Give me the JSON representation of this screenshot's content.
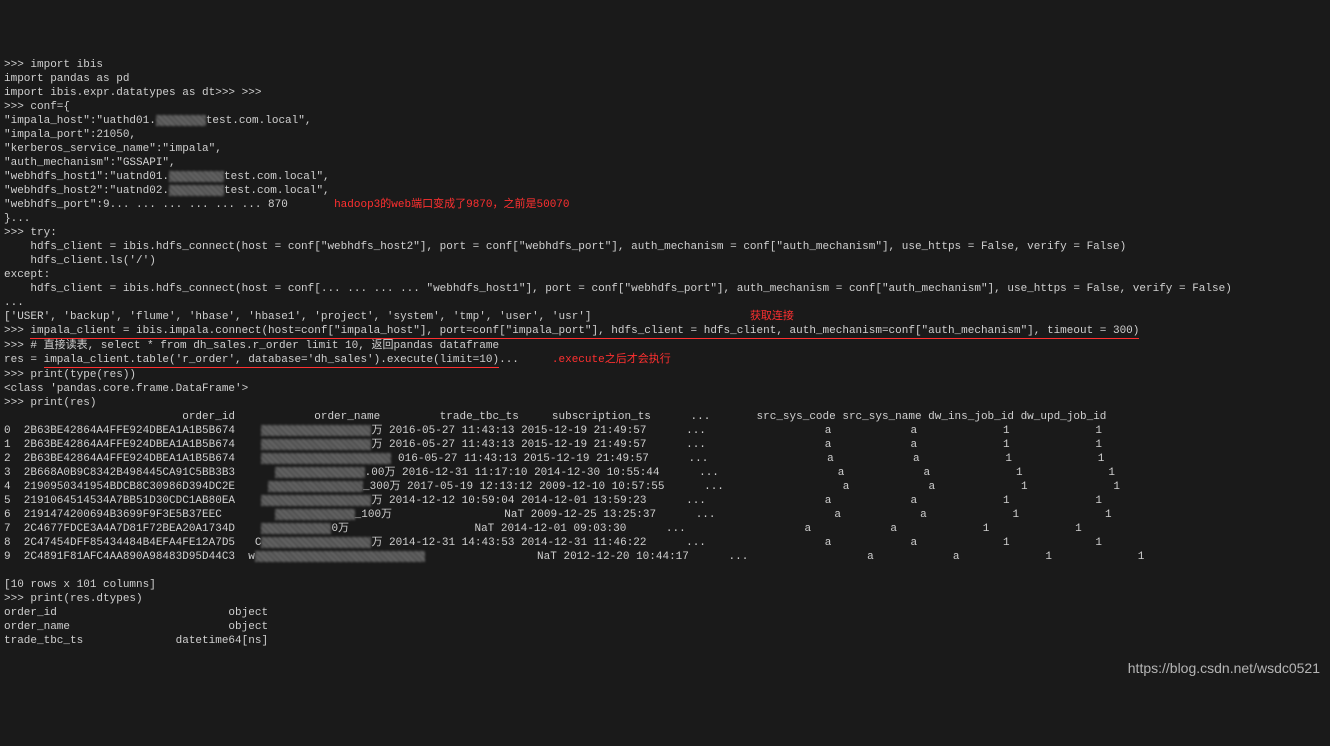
{
  "lines": {
    "l1": ">>> import ibis",
    "l2": "import pandas as pd",
    "l3": "import ibis.expr.datatypes as dt>>> >>>",
    "l4": ">>> conf={",
    "l5": "\"impala_host\":\"uathd01.        test.com.local\",",
    "l6": "\"impala_port\":21050,",
    "l7": "\"kerberos_service_name\":\"impala\",",
    "l8": "\"auth_mechanism\":\"GSSAPI\",",
    "l9": "\"webhdfs_host1\":\"uatnd01.          test.com.local\",",
    "l10": "\"webhdfs_host2\":\"uatnd02.          test.com.local\",",
    "l11": "\"webhdfs_port\":9... ... ... ... ... ... 870",
    "ann1": "hadoop3的web端口变成了9870，之前是50070",
    "l12": "}...",
    "l13": ">>> try:",
    "l14": "    hdfs_client = ibis.hdfs_connect(host = conf[\"webhdfs_host2\"], port = conf[\"webhdfs_port\"], auth_mechanism = conf[\"auth_mechanism\"], use_https = False, verify = False)",
    "l15": "    hdfs_client.ls('/')",
    "l16": "except:",
    "l17": "    hdfs_client = ibis.hdfs_connect(host = conf[... ... ... ... \"webhdfs_host1\"], port = conf[\"webhdfs_port\"], auth_mechanism = conf[\"auth_mechanism\"], use_https = False, verify = False)",
    "l18": "...",
    "l19": "['USER', 'backup', 'flume', 'hbase', 'hbase1', 'project', 'system', 'tmp', 'user', 'usr']",
    "ann2": "获取连接",
    "l20": ">>> impala_client = ibis.impala.connect(host=conf[\"impala_host\"], port=conf[\"impala_port\"], hdfs_client = hdfs_client, auth_mechanism=conf[\"auth_mechanism\"], timeout = 300)",
    "l21": ">>> # 直接读表, select * from dh_sales.r_order limit 10, 返回pandas dataframe",
    "l22": "res = impala_client.table('r_order', database='dh_sales').execute(limit=10)...",
    "ann3": ".execute之后才会执行",
    "l23": ">>> print(type(res))",
    "l24": "<class 'pandas.core.frame.DataFrame'>",
    "l25": ">>> print(res)",
    "hdr": "                           order_id            order_name         trade_tbc_ts     subscription_ts      ...       src_sys_code src_sys_name dw_ins_job_id dw_upd_job_id",
    "r0": "0  2B63BE42864A4FFE924DBEA1A1B5B674                       万 2016-05-27 11:43:13 2015-12-19 21:49:57       ...                  a            a             1             1",
    "r1": "1  2B63BE42864A4FFE924DBEA1A1B5B674                       万 2016-05-27 11:43:13 2015-12-19 21:49:57       ...                  a            a             1             1",
    "r2": "2  2B63BE42864A4FFE924DBEA1A1B5B674                          016-05-27 11:43:13 2015-12-19 21:49:57       ...                  a            a             1             1",
    "r3": "3  2B668A0B9C8342B498445CA91C5BB3B3                    .00万 2016-12-31 11:17:10 2014-12-30 10:55:44       ...                  a            a             1             1",
    "r4": "4  2190950341954BDCB8C30986D394DC2E                    300万 2017-05-19 12:13:12 2009-12-10 10:57:55       ...                  a            a             1             1",
    "r5": "5  2191064514534A7BB51D30CDC1AB80EA                       万 2014-12-12 10:59:04 2014-12-01 13:59:23       ...                  a            a             1             1",
    "r6": "6  2191474200694B3699F9F3E5B37EEC                     _100万                 NaT 2009-12-25 13:25:37       ...                  a            a             1             1",
    "r7": "7  2C4677FDCE3A4A7D81F72BEA20A1734D                    0万                    NaT 2014-12-01 09:03:30       ...                  a            a             1             1",
    "r8": "8  2C47454DFF85434484B4EFA4FE12A7D5   C                   万 2014-12-31 14:43:53 2014-12-31 11:46:22       ...                  a            a             1             1",
    "r9": "9  2C4891F81AFC4AA890A98483D95D44C3  w                                        NaT 2012-12-20 10:44:17       ...                  a            a             1             1",
    "l26": "",
    "l27": "[10 rows x 101 columns]",
    "l28": ">>> print(res.dtypes)",
    "l29": "order_id                          object",
    "l30": "order_name                        object",
    "l31": "trade_tbc_ts              datetime64[ns]"
  },
  "watermark": "https://blog.csdn.net/wsdc0521"
}
